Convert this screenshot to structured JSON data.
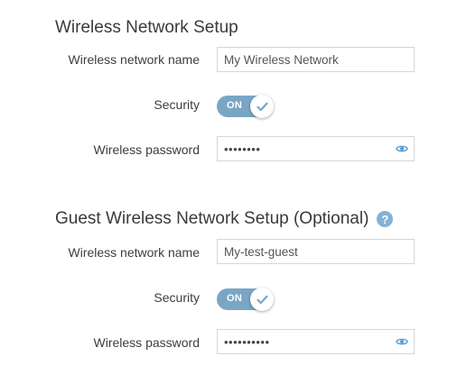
{
  "wireless": {
    "title": "Wireless Network Setup",
    "name_label": "Wireless network name",
    "name_value": "My Wireless Network",
    "security_label": "Security",
    "security_toggle": "ON",
    "password_label": "Wireless password",
    "password_masked": "••••••••"
  },
  "guest": {
    "title": "Guest Wireless Network Setup (Optional)",
    "help": "?",
    "name_label": "Wireless network name",
    "name_value": "My-test-guest",
    "security_label": "Security",
    "security_toggle": "ON",
    "password_label": "Wireless password",
    "password_masked": "••••••••••"
  },
  "colors": {
    "toggle_on": "#7aa6c6",
    "accent": "#5a9fd4",
    "help_icon": "#84b2d4"
  },
  "icons": {
    "eye": "eye-icon",
    "check": "checkmark-icon",
    "help": "help-icon"
  }
}
